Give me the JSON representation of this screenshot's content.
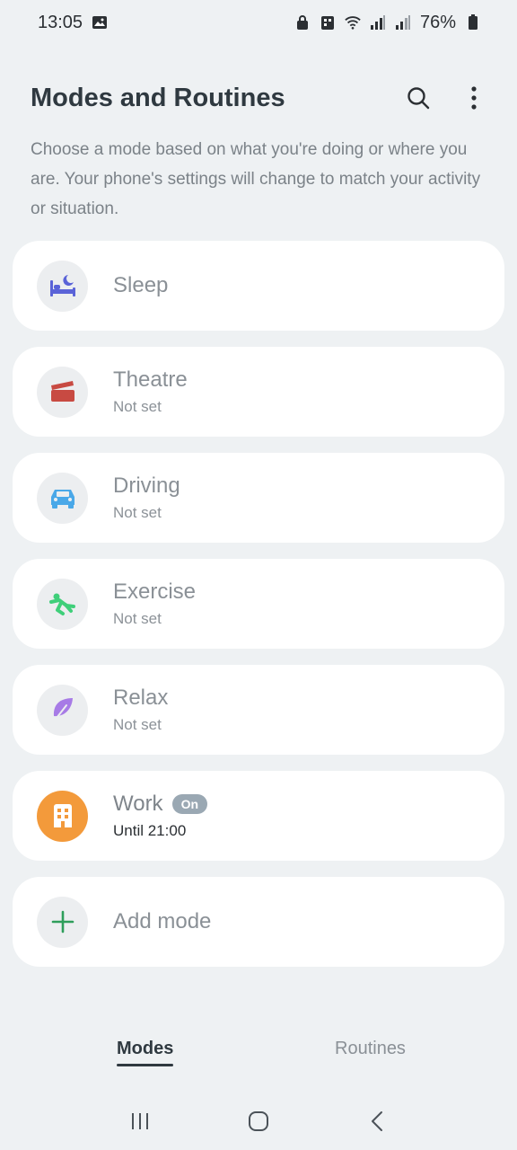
{
  "status_bar": {
    "time": "13:05",
    "battery_percent": "76%",
    "icons": [
      "image-icon",
      "lock-icon",
      "building-icon",
      "wifi-icon",
      "signal-icon",
      "signal-icon",
      "battery-icon"
    ]
  },
  "header": {
    "title": "Modes and Routines",
    "icons": [
      "search-icon",
      "more-vert-icon"
    ]
  },
  "description": "Choose a mode based on what you're doing or where you are. Your phone's settings will change to match your activity or situation.",
  "modes": [
    {
      "title": "Sleep",
      "subtitle": "",
      "icon": "bed-icon",
      "color": "#5a63d8"
    },
    {
      "title": "Theatre",
      "subtitle": "Not set",
      "icon": "clapperboard-icon",
      "color": "#c84a42"
    },
    {
      "title": "Driving",
      "subtitle": "Not set",
      "icon": "car-icon",
      "color": "#4aa8e8"
    },
    {
      "title": "Exercise",
      "subtitle": "Not set",
      "icon": "runner-icon",
      "color": "#3fcf7a"
    },
    {
      "title": "Relax",
      "subtitle": "Not set",
      "icon": "leaf-icon",
      "color": "#a77be6"
    },
    {
      "title": "Work",
      "subtitle": "Until 21:00",
      "badge": "On",
      "icon": "office-building-icon",
      "color": "#f39a3b"
    },
    {
      "title": "Add mode",
      "subtitle": "",
      "icon": "plus-icon",
      "color": "#2e9e5b"
    }
  ],
  "tabs": [
    {
      "label": "Modes",
      "selected": true
    },
    {
      "label": "Routines",
      "selected": false
    }
  ],
  "nav": [
    "recents-icon",
    "home-icon",
    "back-icon"
  ]
}
